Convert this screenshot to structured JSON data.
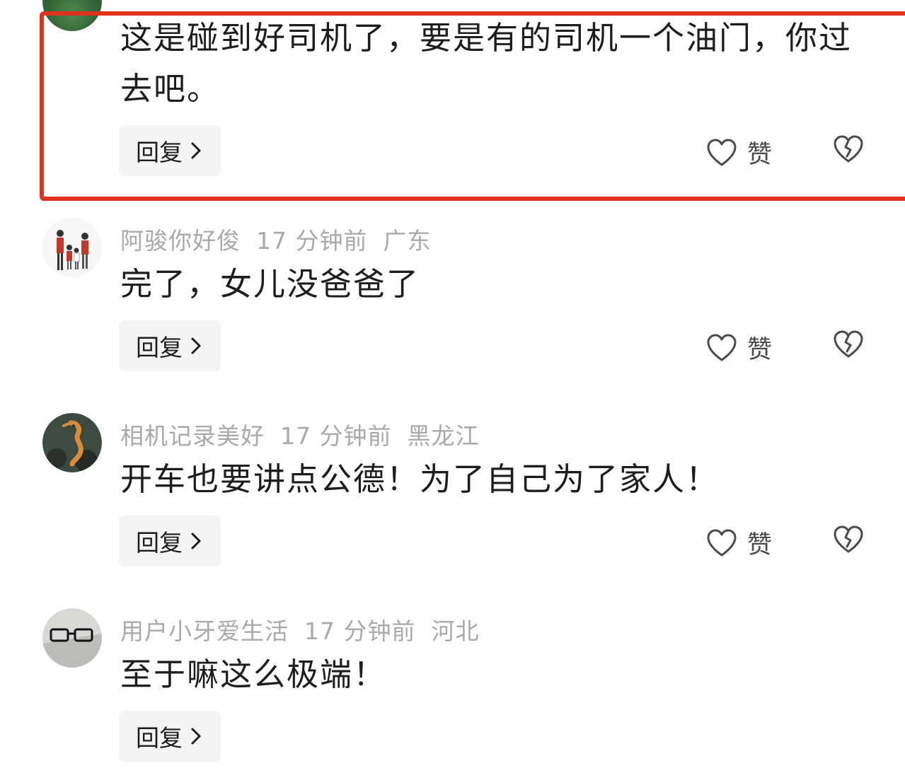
{
  "comments": [
    {
      "text": "这是碰到好司机了，要是有的司机一个油门，你过去吧。",
      "reply_label": "回复",
      "like_label": "赞"
    },
    {
      "username": "阿骏你好俊",
      "time": "17 分钟前",
      "location": "广东",
      "text": "完了，女儿没爸爸了",
      "reply_label": "回复",
      "like_label": "赞"
    },
    {
      "username": "相机记录美好",
      "time": "17 分钟前",
      "location": "黑龙江",
      "text": "开车也要讲点公德！为了自己为了家人！",
      "reply_label": "回复",
      "like_label": "赞"
    },
    {
      "username": "用户小牙爱生活",
      "time": "17 分钟前",
      "location": "河北",
      "text": "至于嘛这么极端！",
      "reply_label": "回复"
    }
  ],
  "icons": {
    "like": "heart-outline-icon",
    "dislike": "broken-heart-icon",
    "reply_chevron": "chevron-right-icon"
  },
  "colors": {
    "highlight": "#e0301e",
    "meta_text": "#a9a9a9",
    "reply_bg": "#f4f4f4"
  }
}
